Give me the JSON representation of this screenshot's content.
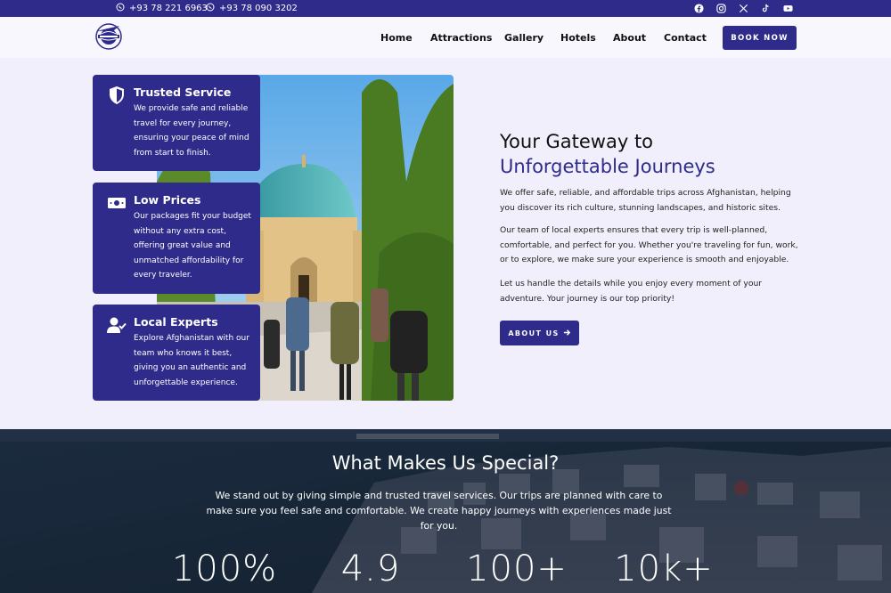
{
  "topbar": {
    "phone1": "+93 78 221 6963",
    "phone2": "+93 78 090 3202",
    "socials": [
      "facebook-icon",
      "instagram-icon",
      "x-icon",
      "tiktok-icon",
      "youtube-icon"
    ]
  },
  "header": {
    "nav": [
      "Home",
      "Attractions",
      "Gallery",
      "Hotels",
      "About",
      "Contact"
    ],
    "book_label": "BOOK NOW"
  },
  "features": [
    {
      "icon": "shield-icon",
      "title": "Trusted Service",
      "text": "We provide safe and reliable travel for every journey, ensuring your peace of mind from start to finish."
    },
    {
      "icon": "money-icon",
      "title": "Low Prices",
      "text": "Our packages fit your budget without any extra cost, offering great value and unmatched affordability for every traveler."
    },
    {
      "icon": "user-check-icon",
      "title": "Local Experts",
      "text": "Explore Afghanistan with our team who knows it best, giving you an authentic and unforgettable experience."
    }
  ],
  "intro": {
    "heading_line1": "Your Gateway to",
    "heading_line2": "Unforgettable Journeys",
    "paragraphs": [
      "We offer safe, reliable, and affordable trips across Afghanistan, helping you discover its rich culture, stunning landscapes, and historic sites.",
      "Our team of local experts ensures that every trip is well-planned, comfortable, and perfect for you. Whether you're traveling for fun, work, or to explore, we make sure your experience is smooth and enjoyable.",
      "Let us handle the details while you enjoy every moment of your adventure. Your journey is our top priority!"
    ],
    "about_label": "ABOUT US"
  },
  "special": {
    "title": "What Makes Us Special?",
    "text": "We stand out by giving simple and trusted travel services. Our trips are planned with care to make sure you feel safe and comfortable. We create happy journeys with experiences made just for you.",
    "stats": [
      "100%",
      "4.9",
      "100+",
      "10k+"
    ]
  },
  "colors": {
    "brand": "#2e2b8a",
    "background": "#f0effb"
  }
}
